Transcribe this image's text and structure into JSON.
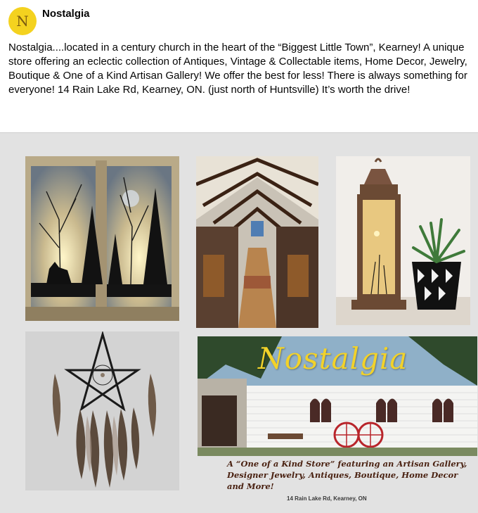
{
  "page": {
    "name": "Nostalgia",
    "avatar_letters": "N",
    "avatar_subtext": "Nostalgia",
    "colors": {
      "avatar_bg": "#f4d21f",
      "text": "#050505",
      "caption": "#4a2212",
      "logo_script": "#f2d22a"
    }
  },
  "post": {
    "text": "Nostalgia....located in a century church in the heart of the “Biggest Little Town”, Kearney!  A unique store offering an eclectic collection of Antiques, Vintage & Collectable items, Home Decor, Jewelry, Boutique & One of a Kind Artisan Gallery!  We offer the best for less!  There is always something for everyone!  14 Rain Lake Rd, Kearney, ON. (just north of Huntsville) It’s worth the drive!"
  },
  "collage": {
    "tiles": [
      {
        "icon": "window-art-photo"
      },
      {
        "icon": "church-interior-photo"
      },
      {
        "icon": "lantern-photo"
      },
      {
        "icon": "dream-catcher-photo"
      },
      {
        "icon": "storefront-photo"
      }
    ],
    "logo_script": "Nostalgia",
    "caption": "A “One of a Kind Store” featuring an Artisan Gallery, Designer Jewelry, Antiques, Boutique,  Home Decor and More!",
    "address": "14 Rain Lake Rd, Kearney, ON"
  }
}
